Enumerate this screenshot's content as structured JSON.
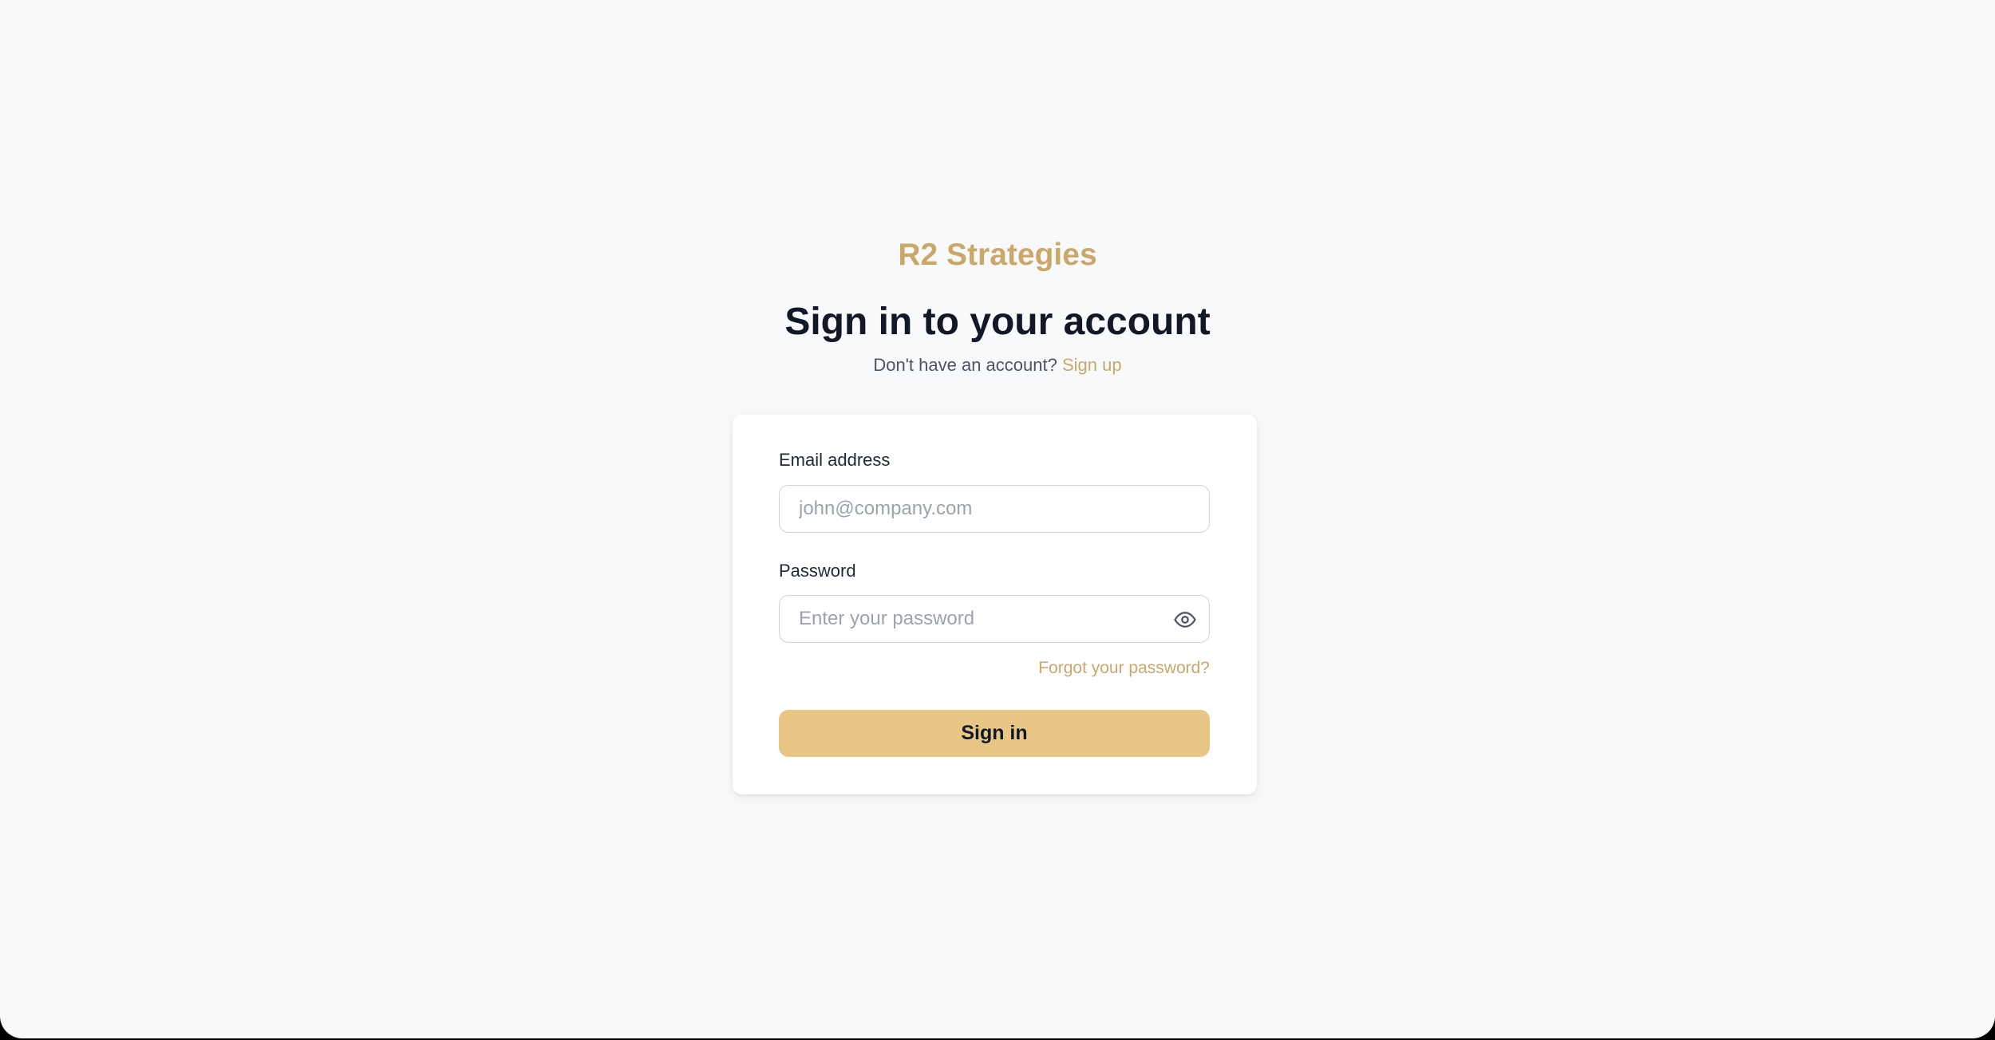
{
  "brand": {
    "name": "R2 Strategies"
  },
  "heading": "Sign in to your account",
  "signup_prompt": {
    "text": "Don't have an account?",
    "link_label": "Sign up"
  },
  "form": {
    "email": {
      "label": "Email address",
      "placeholder": "john@company.com",
      "value": ""
    },
    "password": {
      "label": "Password",
      "placeholder": "Enter your password",
      "value": "",
      "toggle_icon": "eye-icon"
    },
    "forgot_label": "Forgot your password?",
    "submit_label": "Sign in"
  },
  "colors": {
    "accent": "#c9a86a",
    "button": "#e8c685",
    "background": "#f8f9fb",
    "heading": "#111827"
  }
}
